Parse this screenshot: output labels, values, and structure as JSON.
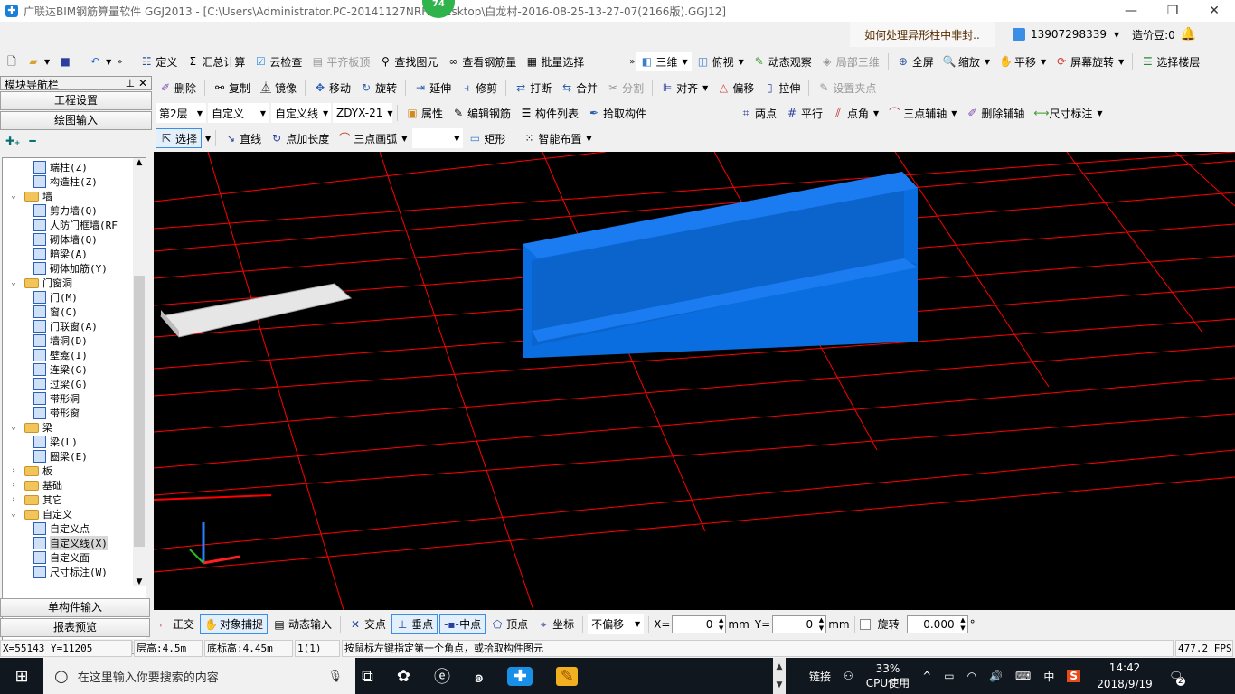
{
  "title": "广联达BIM钢筋算量软件 GGJ2013 - [C:\\Users\\Administrator.PC-20141127NRHI\\Desktop\\白龙村-2016-08-25-13-27-07(2166版).GGJ12]",
  "badge": "74",
  "help_banner": "如何处理异形柱中非封..",
  "user": {
    "phone": "13907298339",
    "beans": "造价豆:0"
  },
  "toolbar1": [
    "定义",
    "汇总计算",
    "云检查",
    "平齐板顶",
    "查找图元",
    "查看钢筋量",
    "批量选择"
  ],
  "toolbar1_right": [
    "三维",
    "俯视",
    "动态观察",
    "局部三维",
    "全屏",
    "缩放",
    "平移",
    "屏幕旋转",
    "选择楼层"
  ],
  "toolbar2": [
    "删除",
    "复制",
    "镜像",
    "移动",
    "旋转",
    "延伸",
    "修剪",
    "打断",
    "合并",
    "分割",
    "对齐",
    "偏移",
    "拉伸",
    "设置夹点"
  ],
  "toolbar3": {
    "floor": "第2层",
    "type": "自定义",
    "subtype": "自定义线",
    "code": "ZDYX-21",
    "buttons": [
      "属性",
      "编辑钢筋",
      "构件列表",
      "拾取构件"
    ]
  },
  "toolbar3_right": [
    "两点",
    "平行",
    "点角",
    "三点辅轴",
    "删除辅轴",
    "尺寸标注"
  ],
  "toolbar4": [
    "选择",
    "直线",
    "点加长度",
    "三点画弧",
    "矩形",
    "智能布置"
  ],
  "nav": {
    "title": "模块导航栏",
    "buttons": [
      "工程设置",
      "绘图输入"
    ],
    "bottom_buttons": [
      "单构件输入",
      "报表预览"
    ],
    "tree": [
      {
        "label": "端柱(Z)",
        "level": 1
      },
      {
        "label": "构造柱(Z)",
        "level": 1
      },
      {
        "label": "墙",
        "level": 0,
        "expanded": true
      },
      {
        "label": "剪力墙(Q)",
        "level": 1
      },
      {
        "label": "人防门框墙(RF",
        "level": 1
      },
      {
        "label": "砌体墙(Q)",
        "level": 1
      },
      {
        "label": "暗梁(A)",
        "level": 1
      },
      {
        "label": "砌体加筋(Y)",
        "level": 1
      },
      {
        "label": "门窗洞",
        "level": 0,
        "expanded": true
      },
      {
        "label": "门(M)",
        "level": 1
      },
      {
        "label": "窗(C)",
        "level": 1
      },
      {
        "label": "门联窗(A)",
        "level": 1
      },
      {
        "label": "墙洞(D)",
        "level": 1
      },
      {
        "label": "壁龛(I)",
        "level": 1
      },
      {
        "label": "连梁(G)",
        "level": 1
      },
      {
        "label": "过梁(G)",
        "level": 1
      },
      {
        "label": "带形洞",
        "level": 1
      },
      {
        "label": "带形窗",
        "level": 1
      },
      {
        "label": "梁",
        "level": 0,
        "expanded": true
      },
      {
        "label": "梁(L)",
        "level": 1
      },
      {
        "label": "圈梁(E)",
        "level": 1
      },
      {
        "label": "板",
        "level": 0,
        "expanded": false
      },
      {
        "label": "基础",
        "level": 0,
        "expanded": false
      },
      {
        "label": "其它",
        "level": 0,
        "expanded": false
      },
      {
        "label": "自定义",
        "level": 0,
        "expanded": true
      },
      {
        "label": "自定义点",
        "level": 1
      },
      {
        "label": "自定义线(X)",
        "level": 1,
        "selected": true
      },
      {
        "label": "自定义面",
        "level": 1
      },
      {
        "label": "尺寸标注(W)",
        "level": 1
      }
    ]
  },
  "bottom_toolbar": {
    "buttons": [
      "正交",
      "对象捕捉",
      "动态输入",
      "交点",
      "垂点",
      "中点",
      "顶点",
      "坐标"
    ],
    "offset": "不偏移",
    "x_label": "X=",
    "x": "0",
    "y_label": "Y=",
    "y": "0",
    "unit": "mm",
    "rotate_label": "旋转",
    "rotate": "0.000",
    "deg": "°"
  },
  "status": {
    "coords": "X=55143 Y=11205",
    "floor_height": "层高:4.5m",
    "base_elev": "底标高:4.45m",
    "count": "1(1)",
    "hint": "按鼠标左键指定第一个角点，或拾取构件图元",
    "fps": "477.2 FPS"
  },
  "taskbar": {
    "search": "在这里输入你要搜索的内容",
    "link": "链接",
    "cpu": "33%",
    "cpu_label": "CPU使用",
    "ime": "中",
    "time": "14:42",
    "date": "2018/9/19",
    "notifications": "2"
  },
  "colors": {
    "canvas": "#000000",
    "grid": "#ff0000",
    "beam": "#0a6ee0",
    "slab": "#e6e6e6"
  }
}
